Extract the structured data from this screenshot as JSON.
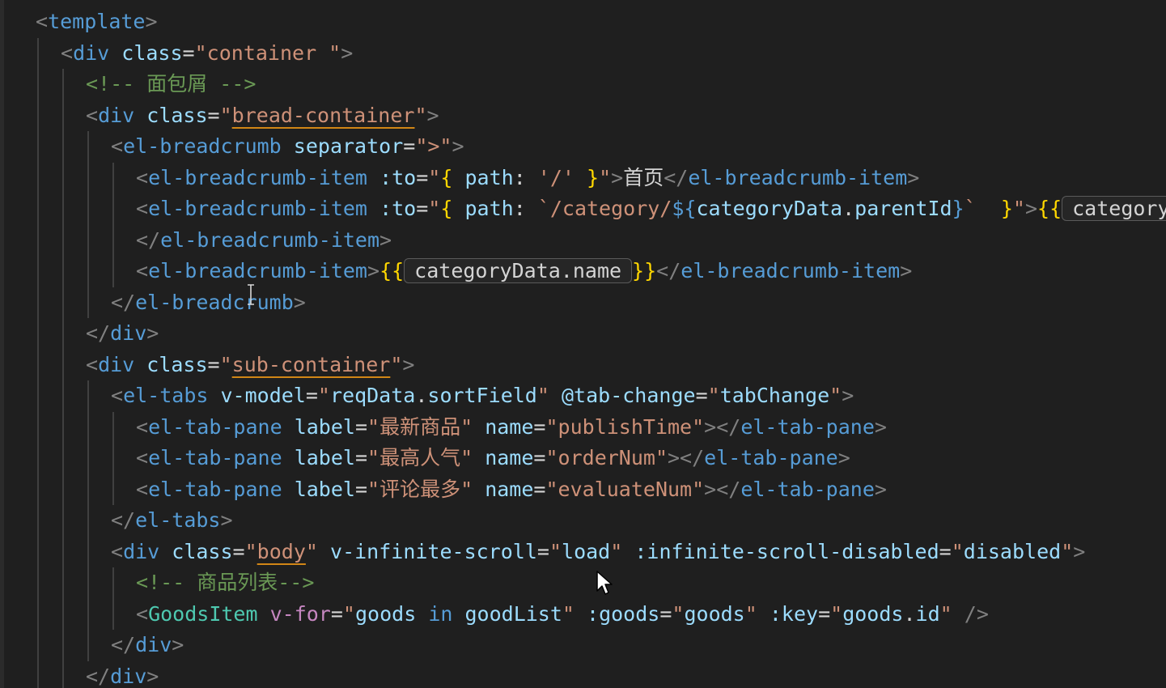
{
  "lines": [
    {
      "indent": 1,
      "tokens": [
        {
          "t": "<",
          "c": "punct"
        },
        {
          "t": "template",
          "c": "tag"
        },
        {
          "t": ">",
          "c": "punct"
        }
      ]
    },
    {
      "indent": 2,
      "tokens": [
        {
          "t": "<",
          "c": "punct"
        },
        {
          "t": "div",
          "c": "tag"
        },
        {
          "t": " ",
          "c": "text"
        },
        {
          "t": "class",
          "c": "attr"
        },
        {
          "t": "=",
          "c": "text"
        },
        {
          "t": "\"container \"",
          "c": "string"
        },
        {
          "t": ">",
          "c": "punct"
        }
      ]
    },
    {
      "indent": 3,
      "tokens": [
        {
          "t": "<!-- 面包屑 -->",
          "c": "comment"
        }
      ]
    },
    {
      "indent": 3,
      "tokens": [
        {
          "t": "<",
          "c": "punct"
        },
        {
          "t": "div",
          "c": "tag"
        },
        {
          "t": " ",
          "c": "text"
        },
        {
          "t": "class",
          "c": "attr"
        },
        {
          "t": "=",
          "c": "text"
        },
        {
          "t": "\"",
          "c": "string"
        },
        {
          "t": "bread-container",
          "c": "link"
        },
        {
          "t": "\"",
          "c": "string"
        },
        {
          "t": ">",
          "c": "punct"
        }
      ]
    },
    {
      "indent": 4,
      "tokens": [
        {
          "t": "<",
          "c": "punct"
        },
        {
          "t": "el-breadcrumb",
          "c": "tag"
        },
        {
          "t": " ",
          "c": "text"
        },
        {
          "t": "separator",
          "c": "attr"
        },
        {
          "t": "=",
          "c": "text"
        },
        {
          "t": "\">\"",
          "c": "string"
        },
        {
          "t": ">",
          "c": "punct"
        }
      ]
    },
    {
      "indent": 5,
      "tokens": [
        {
          "t": "<",
          "c": "punct"
        },
        {
          "t": "el-breadcrumb-item",
          "c": "tag"
        },
        {
          "t": " ",
          "c": "text"
        },
        {
          "t": ":to",
          "c": "attr"
        },
        {
          "t": "=",
          "c": "text"
        },
        {
          "t": "\"",
          "c": "string"
        },
        {
          "t": "{",
          "c": "bracket"
        },
        {
          "t": " ",
          "c": "text"
        },
        {
          "t": "path",
          "c": "var"
        },
        {
          "t": ": ",
          "c": "text"
        },
        {
          "t": "'/'",
          "c": "string"
        },
        {
          "t": " ",
          "c": "text"
        },
        {
          "t": "}",
          "c": "bracket"
        },
        {
          "t": "\"",
          "c": "string"
        },
        {
          "t": ">",
          "c": "punct"
        },
        {
          "t": "首页",
          "c": "text"
        },
        {
          "t": "</",
          "c": "punct"
        },
        {
          "t": "el-breadcrumb-item",
          "c": "tag"
        },
        {
          "t": ">",
          "c": "punct"
        }
      ]
    },
    {
      "indent": 5,
      "tokens": [
        {
          "t": "<",
          "c": "punct"
        },
        {
          "t": "el-breadcrumb-item",
          "c": "tag"
        },
        {
          "t": " ",
          "c": "text"
        },
        {
          "t": ":to",
          "c": "attr"
        },
        {
          "t": "=",
          "c": "text"
        },
        {
          "t": "\"",
          "c": "string"
        },
        {
          "t": "{",
          "c": "bracket"
        },
        {
          "t": " ",
          "c": "text"
        },
        {
          "t": "path",
          "c": "var"
        },
        {
          "t": ": ",
          "c": "text"
        },
        {
          "t": "`/category/",
          "c": "template"
        },
        {
          "t": "${",
          "c": "keyword"
        },
        {
          "t": "categoryData",
          "c": "var"
        },
        {
          "t": ".",
          "c": "text"
        },
        {
          "t": "parentId",
          "c": "var"
        },
        {
          "t": "}",
          "c": "keyword"
        },
        {
          "t": "`",
          "c": "template"
        },
        {
          "t": "  ",
          "c": "text"
        },
        {
          "t": "}",
          "c": "bracket"
        },
        {
          "t": "\"",
          "c": "string"
        },
        {
          "t": ">",
          "c": "punct"
        },
        {
          "t": "{{",
          "c": "bracket"
        },
        {
          "t": "categoryData.parentName",
          "c": "hint"
        }
      ]
    },
    {
      "indent": 5,
      "tokens": [
        {
          "t": "</",
          "c": "punct"
        },
        {
          "t": "el-breadcrumb-item",
          "c": "tag"
        },
        {
          "t": ">",
          "c": "punct"
        }
      ]
    },
    {
      "indent": 5,
      "tokens": [
        {
          "t": "<",
          "c": "punct"
        },
        {
          "t": "el-breadcrumb-item",
          "c": "tag"
        },
        {
          "t": ">",
          "c": "punct"
        },
        {
          "t": "{{",
          "c": "bracket"
        },
        {
          "t": "categoryData.name",
          "c": "hint"
        },
        {
          "t": "}}",
          "c": "bracket"
        },
        {
          "t": "</",
          "c": "punct"
        },
        {
          "t": "el-breadcrumb-item",
          "c": "tag"
        },
        {
          "t": ">",
          "c": "punct"
        }
      ]
    },
    {
      "indent": 4,
      "tokens": [
        {
          "t": "</",
          "c": "punct"
        },
        {
          "t": "el-breadcrumb",
          "c": "tag"
        },
        {
          "t": ">",
          "c": "punct"
        }
      ]
    },
    {
      "indent": 3,
      "tokens": [
        {
          "t": "</",
          "c": "punct"
        },
        {
          "t": "div",
          "c": "tag"
        },
        {
          "t": ">",
          "c": "punct"
        }
      ]
    },
    {
      "indent": 3,
      "tokens": [
        {
          "t": "<",
          "c": "punct"
        },
        {
          "t": "div",
          "c": "tag"
        },
        {
          "t": " ",
          "c": "text"
        },
        {
          "t": "class",
          "c": "attr"
        },
        {
          "t": "=",
          "c": "text"
        },
        {
          "t": "\"",
          "c": "string"
        },
        {
          "t": "sub-container",
          "c": "link"
        },
        {
          "t": "\"",
          "c": "string"
        },
        {
          "t": ">",
          "c": "punct"
        }
      ]
    },
    {
      "indent": 4,
      "tokens": [
        {
          "t": "<",
          "c": "punct"
        },
        {
          "t": "el-tabs",
          "c": "tag"
        },
        {
          "t": " ",
          "c": "text"
        },
        {
          "t": "v-model",
          "c": "attr"
        },
        {
          "t": "=",
          "c": "text"
        },
        {
          "t": "\"",
          "c": "string"
        },
        {
          "t": "reqData",
          "c": "var"
        },
        {
          "t": ".",
          "c": "text"
        },
        {
          "t": "sortField",
          "c": "var"
        },
        {
          "t": "\"",
          "c": "string"
        },
        {
          "t": " ",
          "c": "text"
        },
        {
          "t": "@tab-change",
          "c": "attr"
        },
        {
          "t": "=",
          "c": "text"
        },
        {
          "t": "\"",
          "c": "string"
        },
        {
          "t": "tabChange",
          "c": "var"
        },
        {
          "t": "\"",
          "c": "string"
        },
        {
          "t": ">",
          "c": "punct"
        }
      ]
    },
    {
      "indent": 5,
      "tokens": [
        {
          "t": "<",
          "c": "punct"
        },
        {
          "t": "el-tab-pane",
          "c": "tag"
        },
        {
          "t": " ",
          "c": "text"
        },
        {
          "t": "label",
          "c": "attr"
        },
        {
          "t": "=",
          "c": "text"
        },
        {
          "t": "\"最新商品\"",
          "c": "string"
        },
        {
          "t": " ",
          "c": "text"
        },
        {
          "t": "name",
          "c": "attr"
        },
        {
          "t": "=",
          "c": "text"
        },
        {
          "t": "\"publishTime\"",
          "c": "string"
        },
        {
          "t": "></",
          "c": "punct"
        },
        {
          "t": "el-tab-pane",
          "c": "tag"
        },
        {
          "t": ">",
          "c": "punct"
        }
      ]
    },
    {
      "indent": 5,
      "tokens": [
        {
          "t": "<",
          "c": "punct"
        },
        {
          "t": "el-tab-pane",
          "c": "tag"
        },
        {
          "t": " ",
          "c": "text"
        },
        {
          "t": "label",
          "c": "attr"
        },
        {
          "t": "=",
          "c": "text"
        },
        {
          "t": "\"最高人气\"",
          "c": "string"
        },
        {
          "t": " ",
          "c": "text"
        },
        {
          "t": "name",
          "c": "attr"
        },
        {
          "t": "=",
          "c": "text"
        },
        {
          "t": "\"orderNum\"",
          "c": "string"
        },
        {
          "t": "></",
          "c": "punct"
        },
        {
          "t": "el-tab-pane",
          "c": "tag"
        },
        {
          "t": ">",
          "c": "punct"
        }
      ]
    },
    {
      "indent": 5,
      "tokens": [
        {
          "t": "<",
          "c": "punct"
        },
        {
          "t": "el-tab-pane",
          "c": "tag"
        },
        {
          "t": " ",
          "c": "text"
        },
        {
          "t": "label",
          "c": "attr"
        },
        {
          "t": "=",
          "c": "text"
        },
        {
          "t": "\"评论最多\"",
          "c": "string"
        },
        {
          "t": " ",
          "c": "text"
        },
        {
          "t": "name",
          "c": "attr"
        },
        {
          "t": "=",
          "c": "text"
        },
        {
          "t": "\"evaluateNum\"",
          "c": "string"
        },
        {
          "t": "></",
          "c": "punct"
        },
        {
          "t": "el-tab-pane",
          "c": "tag"
        },
        {
          "t": ">",
          "c": "punct"
        }
      ]
    },
    {
      "indent": 4,
      "tokens": [
        {
          "t": "</",
          "c": "punct"
        },
        {
          "t": "el-tabs",
          "c": "tag"
        },
        {
          "t": ">",
          "c": "punct"
        }
      ]
    },
    {
      "indent": 4,
      "tokens": [
        {
          "t": "<",
          "c": "punct"
        },
        {
          "t": "div",
          "c": "tag"
        },
        {
          "t": " ",
          "c": "text"
        },
        {
          "t": "class",
          "c": "attr"
        },
        {
          "t": "=",
          "c": "text"
        },
        {
          "t": "\"",
          "c": "string"
        },
        {
          "t": "body",
          "c": "link"
        },
        {
          "t": "\"",
          "c": "string"
        },
        {
          "t": " ",
          "c": "text"
        },
        {
          "t": "v-infinite-scroll",
          "c": "attr"
        },
        {
          "t": "=",
          "c": "text"
        },
        {
          "t": "\"",
          "c": "string"
        },
        {
          "t": "load",
          "c": "var"
        },
        {
          "t": "\"",
          "c": "string"
        },
        {
          "t": " ",
          "c": "text"
        },
        {
          "t": ":infinite-scroll-disabled",
          "c": "attr"
        },
        {
          "t": "=",
          "c": "text"
        },
        {
          "t": "\"",
          "c": "string"
        },
        {
          "t": "disabled",
          "c": "var"
        },
        {
          "t": "\"",
          "c": "string"
        },
        {
          "t": ">",
          "c": "punct"
        }
      ]
    },
    {
      "indent": 5,
      "tokens": [
        {
          "t": "<!-- 商品列表-->",
          "c": "comment"
        }
      ]
    },
    {
      "indent": 5,
      "tokens": [
        {
          "t": "<",
          "c": "punct"
        },
        {
          "t": "GoodsItem",
          "c": "component"
        },
        {
          "t": " ",
          "c": "text"
        },
        {
          "t": "v-for",
          "c": "directive"
        },
        {
          "t": "=",
          "c": "text"
        },
        {
          "t": "\"",
          "c": "string"
        },
        {
          "t": "goods",
          "c": "var"
        },
        {
          "t": " ",
          "c": "text"
        },
        {
          "t": "in",
          "c": "keyword"
        },
        {
          "t": " ",
          "c": "text"
        },
        {
          "t": "goodList",
          "c": "var"
        },
        {
          "t": "\"",
          "c": "string"
        },
        {
          "t": " ",
          "c": "text"
        },
        {
          "t": ":goods",
          "c": "attr"
        },
        {
          "t": "=",
          "c": "text"
        },
        {
          "t": "\"",
          "c": "string"
        },
        {
          "t": "goods",
          "c": "var"
        },
        {
          "t": "\"",
          "c": "string"
        },
        {
          "t": " ",
          "c": "text"
        },
        {
          "t": ":key",
          "c": "attr"
        },
        {
          "t": "=",
          "c": "text"
        },
        {
          "t": "\"",
          "c": "string"
        },
        {
          "t": "goods",
          "c": "var"
        },
        {
          "t": ".",
          "c": "text"
        },
        {
          "t": "id",
          "c": "var"
        },
        {
          "t": "\"",
          "c": "string"
        },
        {
          "t": " ",
          "c": "text"
        },
        {
          "t": "/>",
          "c": "punct"
        }
      ]
    },
    {
      "indent": 4,
      "tokens": [
        {
          "t": "</",
          "c": "punct"
        },
        {
          "t": "div",
          "c": "tag"
        },
        {
          "t": ">",
          "c": "punct"
        }
      ]
    },
    {
      "indent": 3,
      "tokens": [
        {
          "t": "</",
          "c": "punct"
        },
        {
          "t": "div",
          "c": "tag"
        },
        {
          "t": ">",
          "c": "punct"
        }
      ]
    }
  ]
}
